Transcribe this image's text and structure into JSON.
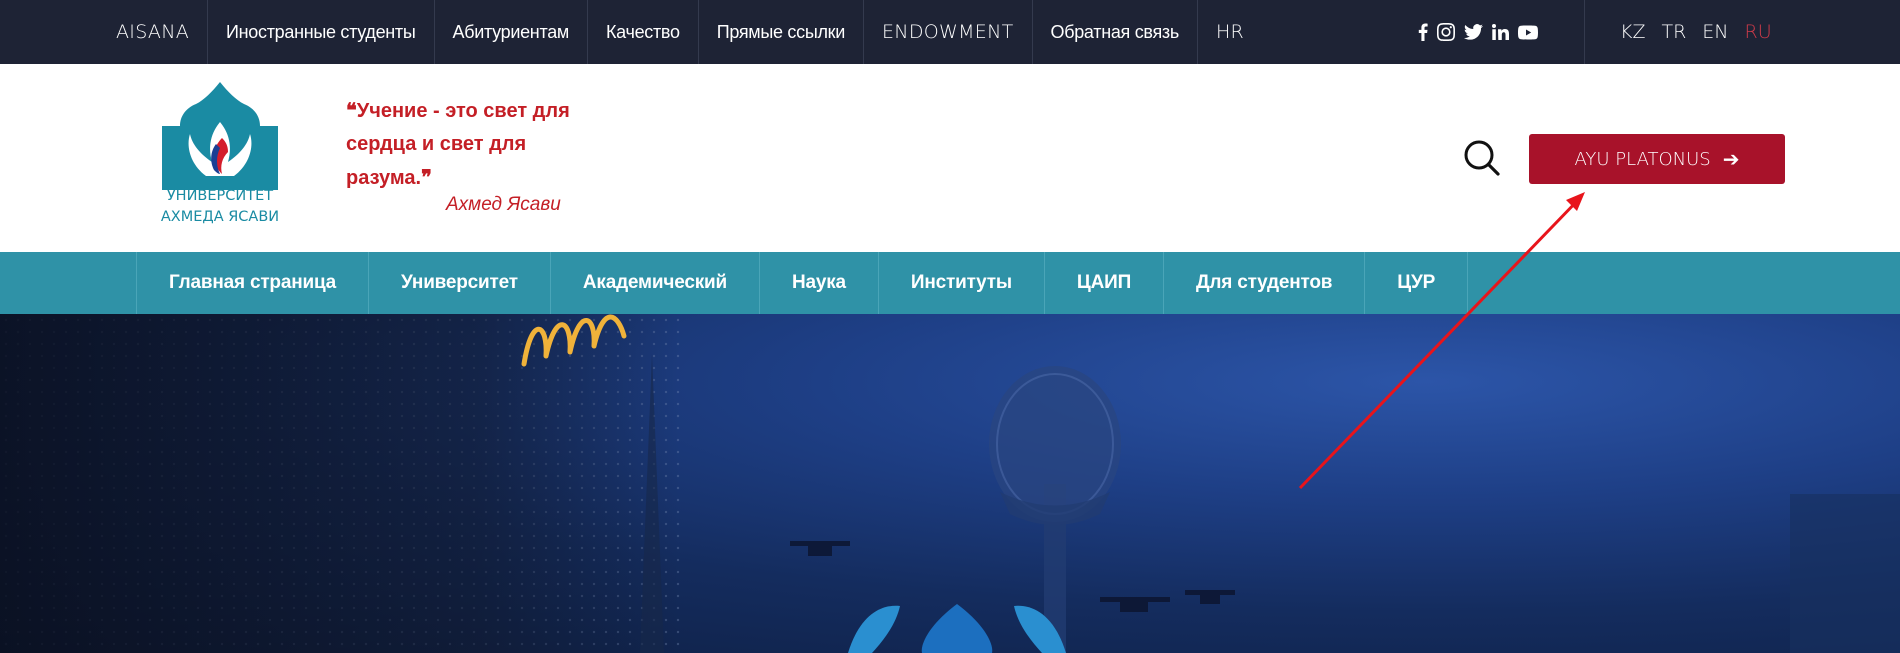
{
  "topbar": {
    "nav": [
      "AISANA",
      "Иностранные студенты",
      "Абитуриентам",
      "Качество",
      "Прямые ссылки",
      "ENDOWMENT",
      "Обратная связь",
      "HR"
    ],
    "social_icons": [
      "facebook-icon",
      "instagram-icon",
      "twitter-icon",
      "linkedin-icon",
      "youtube-icon"
    ],
    "languages": [
      "KZ",
      "TR",
      "EN",
      "RU"
    ],
    "active_language": "RU"
  },
  "header": {
    "logo_line1": "УНИВЕРСИТЕТ",
    "logo_line2": "АХМЕДА ЯСАВИ",
    "quote_open": "❝",
    "quote_text": "Учение - это свет для сердца и свет для разума.",
    "quote_close": "❞",
    "quote_author": "Ахмед Ясави",
    "search_icon": "search-icon",
    "platonus_label": "AYU PLATONUS",
    "platonus_arrow": "➔"
  },
  "mainnav": {
    "items": [
      "Главная страница",
      "Университет",
      "Академический",
      "Наука",
      "Институты",
      "ЦАИП",
      "Для студентов",
      "ЦУР"
    ]
  },
  "colors": {
    "topbar_bg": "#1e2335",
    "nav_bg": "#2f92a7",
    "button_bg": "#a8122a",
    "quote_color": "#c41f26",
    "logo_color": "#1a8ba3",
    "active_lang": "#d23b4a",
    "annotation_arrow": "#e8141b"
  }
}
